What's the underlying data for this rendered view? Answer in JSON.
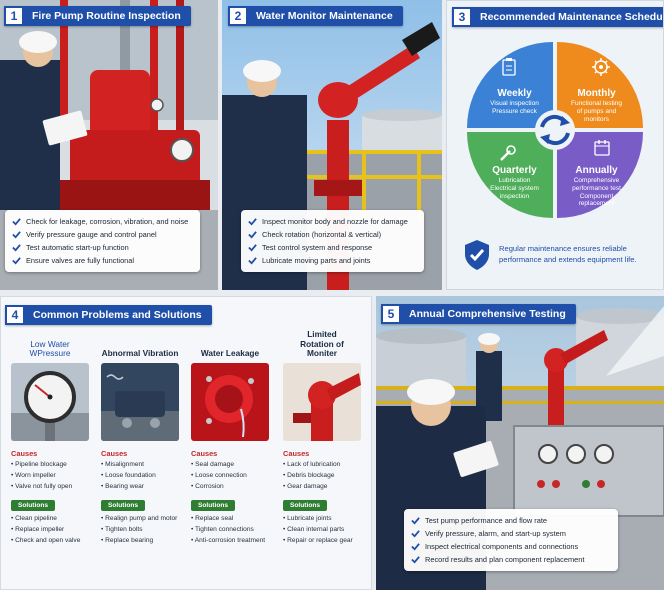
{
  "panel1": {
    "number": "1",
    "title": "Fire Pump Routine Inspection",
    "checks": [
      "Check for leakage, corrosion, vibration, and noise",
      "Verify pressure gauge and control panel",
      "Test automatic start-up function",
      "Ensure valves are fully functional"
    ]
  },
  "panel2": {
    "number": "2",
    "title": "Water Monitor Maintenance",
    "checks": [
      "Inspect monitor body and nozzle for damage",
      "Check rotation (horizontal & vertical)",
      "Test control system and response",
      "Lubricate moving parts and joints"
    ]
  },
  "panel3": {
    "number": "3",
    "title": "Recommended Maintenance Schedule",
    "wedges": [
      {
        "title": "Weekly",
        "desc": "Visual inspection\nPressure check"
      },
      {
        "title": "Monthly",
        "desc": "Functional testing\nof pumps and\nmonitors"
      },
      {
        "title": "Quarterly",
        "desc": "Lubrication\nElectrical system\ninspection"
      },
      {
        "title": "Annually",
        "desc": "Comprehensive\nperformance test\nComponent\nreplacement"
      }
    ],
    "note": "Regular maintenance ensures reliable performance and extends equipment life.",
    "colors": {
      "weekly": "#3b82d6",
      "monthly": "#ef8a1c",
      "quarterly": "#4fae5a",
      "annually": "#7a5cc7"
    }
  },
  "panel4": {
    "number": "4",
    "title": "Common Problems and Solutions",
    "causes_label": "Causes",
    "solutions_label": "Solutions",
    "problems": [
      {
        "title": "Low Water WPressure",
        "causes": [
          "Pipeline blockage",
          "Worn impeller",
          "Valve not fully open"
        ],
        "solutions": [
          "Clean pipeline",
          "Replace impeller",
          "Check and open valve"
        ]
      },
      {
        "title": "Abnormal Vibration",
        "causes": [
          "Misalignment",
          "Loose foundation",
          "Bearing wear"
        ],
        "solutions": [
          "Realign pump and motor",
          "Tighten bolts",
          "Replace bearing"
        ]
      },
      {
        "title": "Water Leakage",
        "causes": [
          "Seal damage",
          "Loose connection",
          "Corrosion"
        ],
        "solutions": [
          "Replace seal",
          "Tighten connections",
          "Anti-corrosion treatment"
        ]
      },
      {
        "title": "Limited Rotation of Moniter",
        "causes": [
          "Lack of lubrication",
          "Debris blockage",
          "Gear damage"
        ],
        "solutions": [
          "Lubricate joints",
          "Clean internal parts",
          "Repair or replace gear"
        ]
      }
    ]
  },
  "panel5": {
    "number": "5",
    "title": "Annual Comprehensive Testing",
    "checks": [
      "Test pump performance and flow rate",
      "Verify pressure, alarm, and start-up system",
      "Inspect electrical components and connections",
      "Record results and plan component replacement"
    ]
  }
}
